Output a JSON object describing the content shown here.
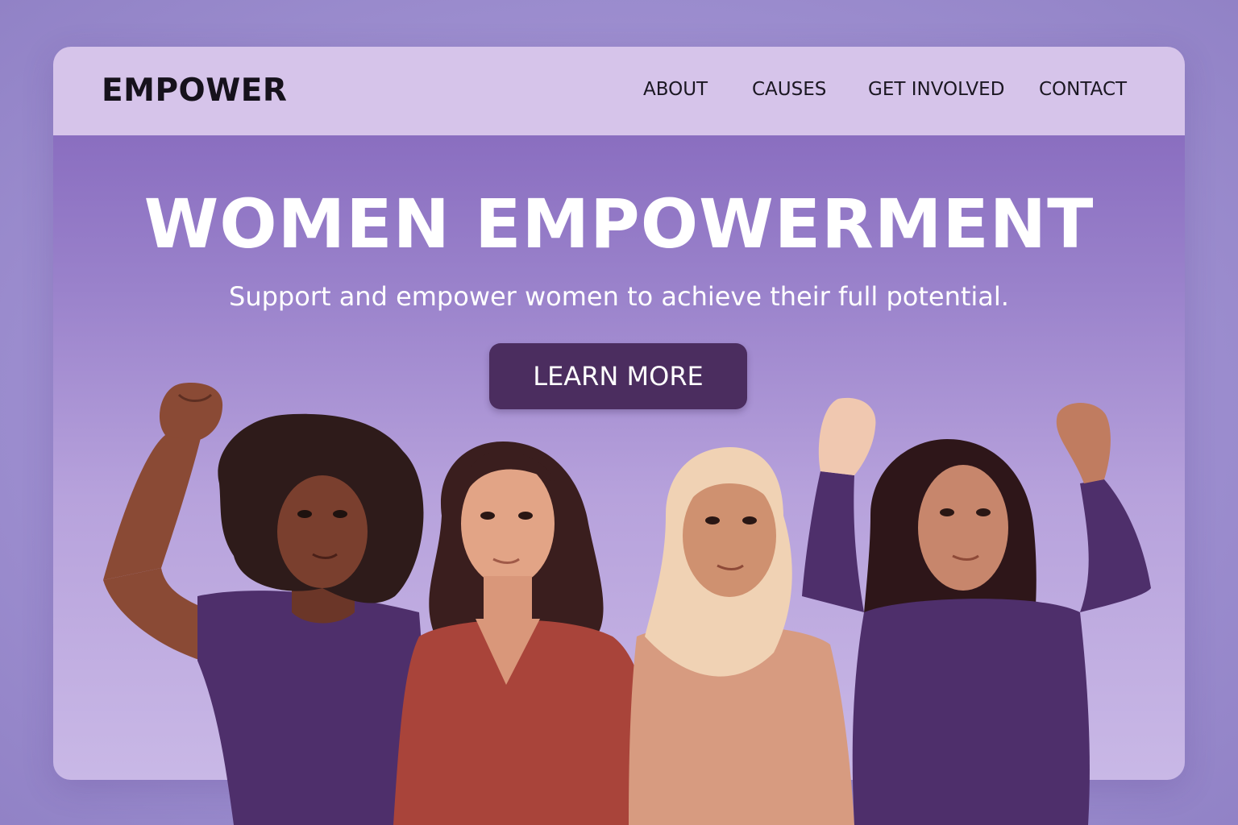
{
  "brand": {
    "logo": "EMPOWER"
  },
  "nav": {
    "items": [
      {
        "label": "ABOUT"
      },
      {
        "label": "CAUSES"
      },
      {
        "label": "GET INVOLVED"
      },
      {
        "label": "CONTACT"
      }
    ]
  },
  "hero": {
    "title": "WOMEN EMPOWERMENT",
    "subtitle": "Support and empower women to achieve their full potential.",
    "cta_label": "LEARN MORE"
  },
  "colors": {
    "page_background": "#9e8fd0",
    "navbar": "#d6c4ea",
    "hero_top": "#8a6ec0",
    "hero_bottom": "#c9b8e6",
    "button": "#4b2d5f",
    "text_light": "#ffffff",
    "text_dark": "#16121c"
  }
}
